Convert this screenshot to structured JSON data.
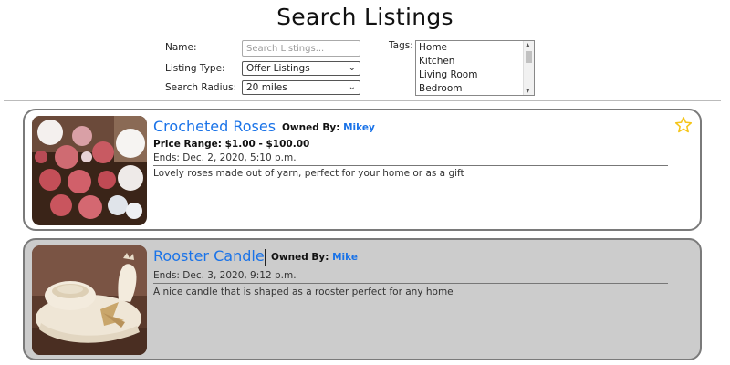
{
  "page": {
    "title": "Search Listings"
  },
  "filters": {
    "name_label": "Name:",
    "name_placeholder": "Search Listings...",
    "name_value": "",
    "type_label": "Listing Type:",
    "type_value": "Offer Listings",
    "radius_label": "Search Radius:",
    "radius_value": "20 miles",
    "tags_label": "Tags:",
    "tags_options": [
      "Home",
      "Kitchen",
      "Living Room",
      "Bedroom"
    ]
  },
  "listings": [
    {
      "title": "Crocheted Roses",
      "owned_by_label": "Owned By:",
      "owner": "Mikey",
      "price_range": "Price Range: $1.00 - $100.00",
      "ends": "Ends: Dec. 2, 2020, 5:10 p.m.",
      "description": "Lovely roses made out of yarn, perfect for your home or as a gift",
      "favorite_icon": "star-outline-icon",
      "star_color": "#f5c518"
    },
    {
      "title": "Rooster Candle",
      "owned_by_label": "Owned By:",
      "owner": "Mike",
      "ends": "Ends: Dec. 3, 2020, 9:12 p.m.",
      "description": "A nice candle that is shaped as a rooster perfect for any home"
    }
  ],
  "colors": {
    "link": "#1a73e8",
    "card_inactive_bg": "#cccccc",
    "card_border": "#7a7a7a"
  }
}
